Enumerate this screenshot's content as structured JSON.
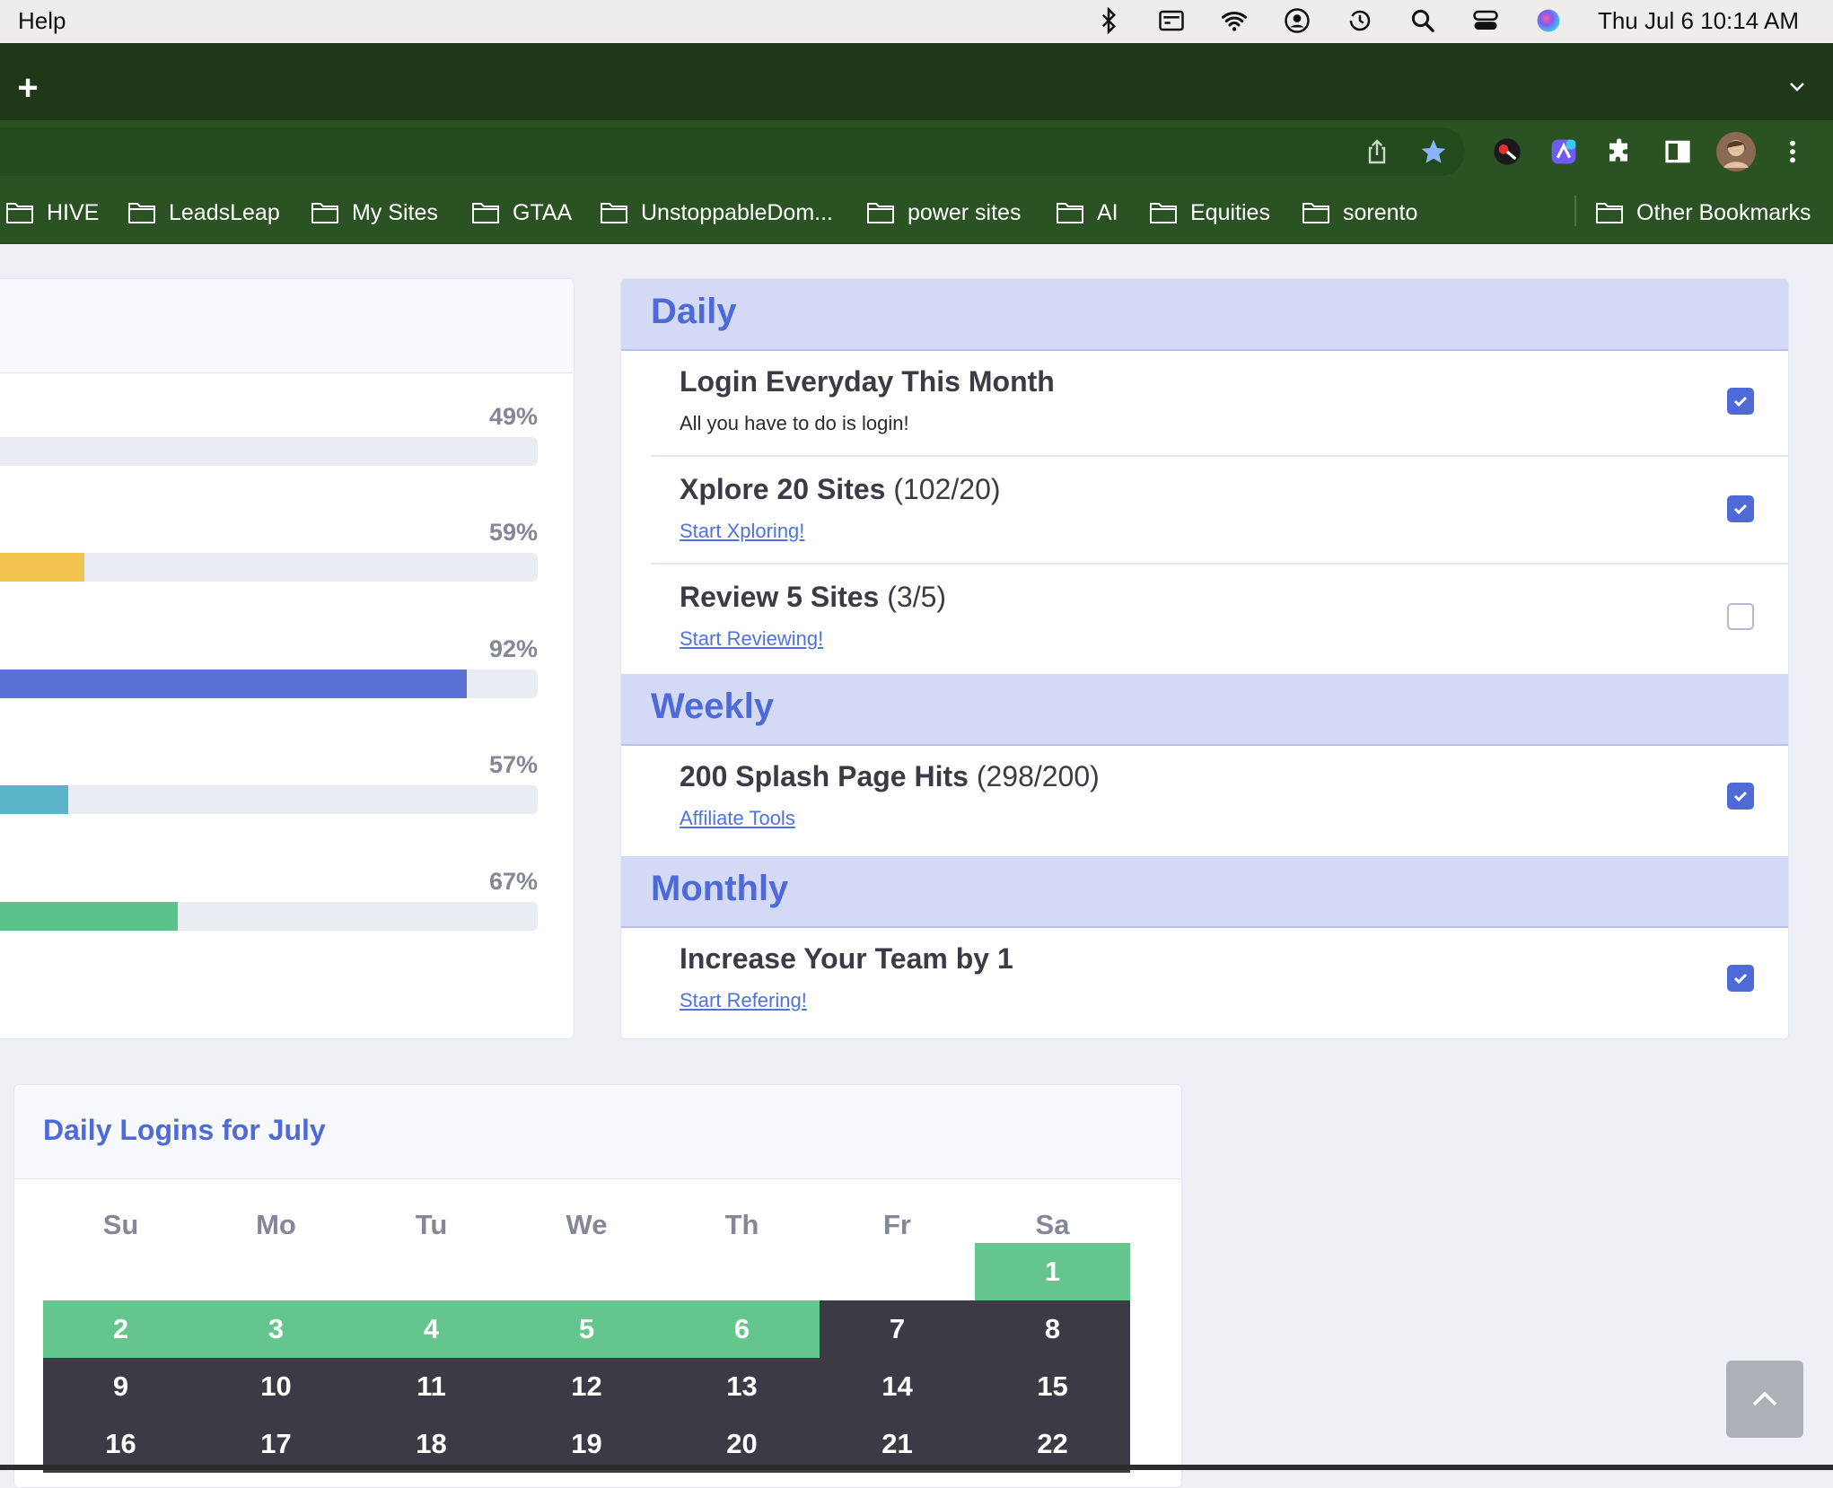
{
  "menubar": {
    "app_menu": "Help",
    "clock": "Thu Jul 6  10:14 AM",
    "status_icons": [
      "bluetooth-icon",
      "input-source-icon",
      "wifi-icon",
      "user-icon",
      "time-machine-icon",
      "spotlight-icon",
      "control-center-icon",
      "siri-icon"
    ]
  },
  "browser": {
    "new_tab_symbol": "+",
    "toolbar_icons": [
      "share-icon",
      "bookmark-star-icon",
      "extension-key-icon",
      "extension-app-icon",
      "extensions-puzzle-icon",
      "side-panel-icon",
      "profile-avatar",
      "menu-kebab-icon"
    ],
    "bookmarks": [
      "HIVE",
      "LeadsLeap",
      "My Sites",
      "GTAA",
      "UnstoppableDom...",
      "power sites",
      "AI",
      "Equities",
      "sorento"
    ],
    "other_bookmarks": "Other Bookmarks"
  },
  "progress": {
    "items": [
      {
        "label": "49%",
        "fill_fraction": 0.0,
        "color": "#858796"
      },
      {
        "label": "59%",
        "fill_fraction": 0.17,
        "color": "#f0c44f"
      },
      {
        "label": "92%",
        "fill_fraction": 0.87,
        "color": "#5a72d8"
      },
      {
        "label": "57%",
        "fill_fraction": 0.14,
        "color": "#5ab5c8"
      },
      {
        "label": "67%",
        "fill_fraction": 0.34,
        "color": "#58c28a"
      }
    ]
  },
  "goals": {
    "daily": {
      "heading": "Daily",
      "items": [
        {
          "title": "Login Everyday This Month",
          "count": "",
          "subtitle": "All you have to do is login!",
          "link": "",
          "checked": true
        },
        {
          "title": "Xplore 20 Sites",
          "count": "(102/20)",
          "subtitle": "",
          "link": "Start Xploring!",
          "checked": true
        },
        {
          "title": "Review 5 Sites",
          "count": "(3/5)",
          "subtitle": "",
          "link": "Start Reviewing!",
          "checked": false
        }
      ]
    },
    "weekly": {
      "heading": "Weekly",
      "items": [
        {
          "title": "200 Splash Page Hits",
          "count": "(298/200)",
          "subtitle": "",
          "link": "Affiliate Tools",
          "checked": true
        }
      ]
    },
    "monthly": {
      "heading": "Monthly",
      "items": [
        {
          "title": "Increase Your Team by 1",
          "count": "",
          "subtitle": "",
          "link": "Start Refering!",
          "checked": true
        }
      ]
    }
  },
  "calendar": {
    "title": "Daily Logins for July",
    "weekdays": [
      "Su",
      "Mo",
      "Tu",
      "We",
      "Th",
      "Fr",
      "Sa"
    ],
    "weeks": [
      [
        "",
        "",
        "",
        "",
        "",
        "",
        "1"
      ],
      [
        "2",
        "3",
        "4",
        "5",
        "6",
        "7",
        "8"
      ],
      [
        "9",
        "10",
        "11",
        "12",
        "13",
        "14",
        "15"
      ],
      [
        "16",
        "17",
        "18",
        "19",
        "20",
        "21",
        "22"
      ]
    ],
    "logged_in_days": [
      "1",
      "2",
      "3",
      "4",
      "5",
      "6"
    ],
    "colors": {
      "logged_in": "#64c68d",
      "not_logged": "#3a3b45"
    }
  }
}
